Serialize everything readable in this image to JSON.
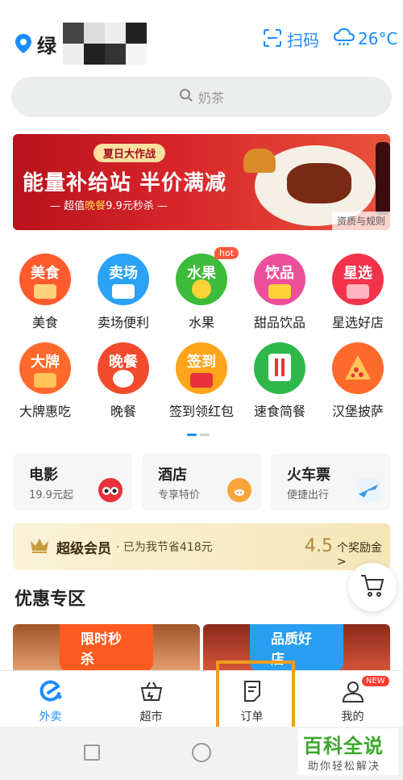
{
  "header": {
    "location_text": "绿",
    "scan_label": "扫码",
    "weather_label": "26°C"
  },
  "search": {
    "placeholder": "奶茶"
  },
  "banner": {
    "tag": "夏日大作战",
    "title": "能量补给站 半价满减",
    "subtitle_prefix": "— 超值",
    "subtitle_highlight": "晚餐",
    "subtitle_suffix": "9.9元秒杀 —",
    "rules_label": "资质与规则"
  },
  "categories": [
    {
      "icon_text": "美食",
      "label": "美食",
      "color": "#ff5b2e"
    },
    {
      "icon_text": "卖场",
      "label": "卖场便利",
      "color": "#2aa2f5"
    },
    {
      "icon_text": "水果",
      "label": "水果",
      "color": "#3dbb3a",
      "badge": "hot"
    },
    {
      "icon_text": "饮品",
      "label": "甜品饮品",
      "color": "#ee4f9a"
    },
    {
      "icon_text": "星选",
      "label": "星选好店",
      "color": "#f2334b"
    },
    {
      "icon_text": "大牌",
      "label": "大牌惠吃",
      "color": "#ff6a2c"
    },
    {
      "icon_text": "晚餐",
      "label": "晚餐",
      "color": "#f24a2c"
    },
    {
      "icon_text": "签到",
      "label": "签到领红包",
      "color": "#ffa41b"
    },
    {
      "icon_text": "",
      "label": "速食简餐",
      "color": "#2fb84a"
    },
    {
      "icon_text": "",
      "label": "汉堡披萨",
      "color": "#ff6a2a"
    }
  ],
  "page_dots": {
    "active_color": "#1a8cff",
    "inactive_color": "#cccccc"
  },
  "services": [
    {
      "title": "电影",
      "subtitle": "19.9元起",
      "icon": "movie-glasses-icon",
      "color": "#e8313a"
    },
    {
      "title": "酒店",
      "subtitle": "专享特价",
      "icon": "hotel-pig-icon",
      "color": "#f7a53a"
    },
    {
      "title": "火车票",
      "subtitle": "便捷出行",
      "icon": "train-plane-icon",
      "color": "#3a9ae8"
    }
  ],
  "member": {
    "title": "超级会员",
    "saved_text": "· 已为我节省418元",
    "reward_num": "4.5",
    "reward_label": "个奖励金>"
  },
  "section_title": "优惠专区",
  "promos": [
    {
      "label": "限时秒杀",
      "label_color": "#ff5a1f"
    },
    {
      "label": "品质好店",
      "label_color": "#2a9ef0"
    }
  ],
  "bottom_nav": [
    {
      "label": "外卖",
      "icon": "eleme-icon",
      "active": true
    },
    {
      "label": "超市",
      "icon": "basket-icon",
      "active": false
    },
    {
      "label": "订单",
      "icon": "order-icon",
      "active": false
    },
    {
      "label": "我的",
      "icon": "profile-icon",
      "active": false,
      "badge": "NEW"
    }
  ],
  "watermark": {
    "title": "百科全说",
    "subtitle": "助你轻松解决"
  }
}
